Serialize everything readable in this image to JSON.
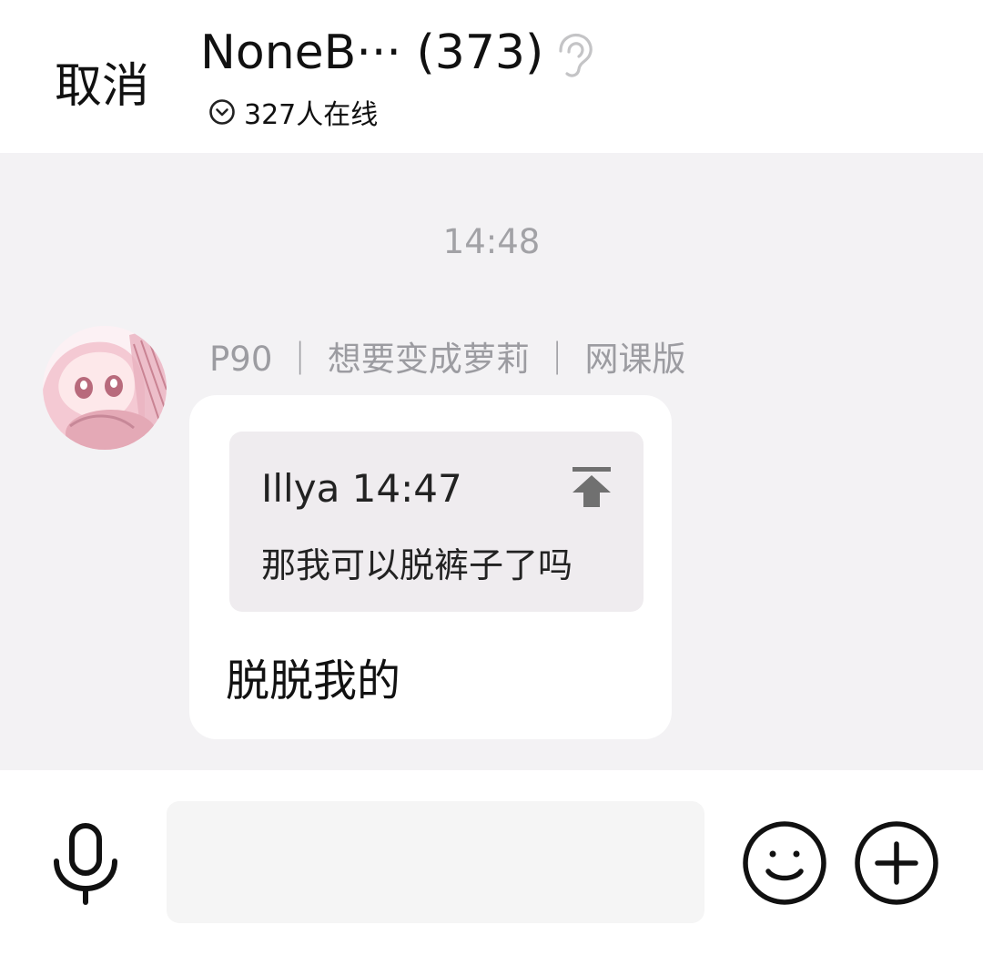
{
  "header": {
    "cancel_label": "取消",
    "title": "NoneB··· (373)",
    "online_text": "327人在线"
  },
  "chat": {
    "timestamp": "14:48",
    "message": {
      "sender": "P90 ｜ 想要变成萝莉 ｜ 网课版",
      "quote": {
        "meta": "Illya 14:47",
        "text": "那我可以脱裤子了吗"
      },
      "text": "脱脱我的"
    }
  },
  "input": {
    "value": "",
    "placeholder": ""
  },
  "icons": {
    "title_icon": "ear-icon",
    "online_icon": "chevron-down-circle-icon",
    "quote_icon": "jump-to-top-icon",
    "voice_icon": "microphone-icon",
    "emoji_icon": "smiley-icon",
    "more_icon": "plus-circle-icon"
  },
  "colors": {
    "background": "#f3f2f4",
    "bubble": "#ffffff",
    "quote_background": "#efecef",
    "muted_text": "#a2a2a6"
  }
}
